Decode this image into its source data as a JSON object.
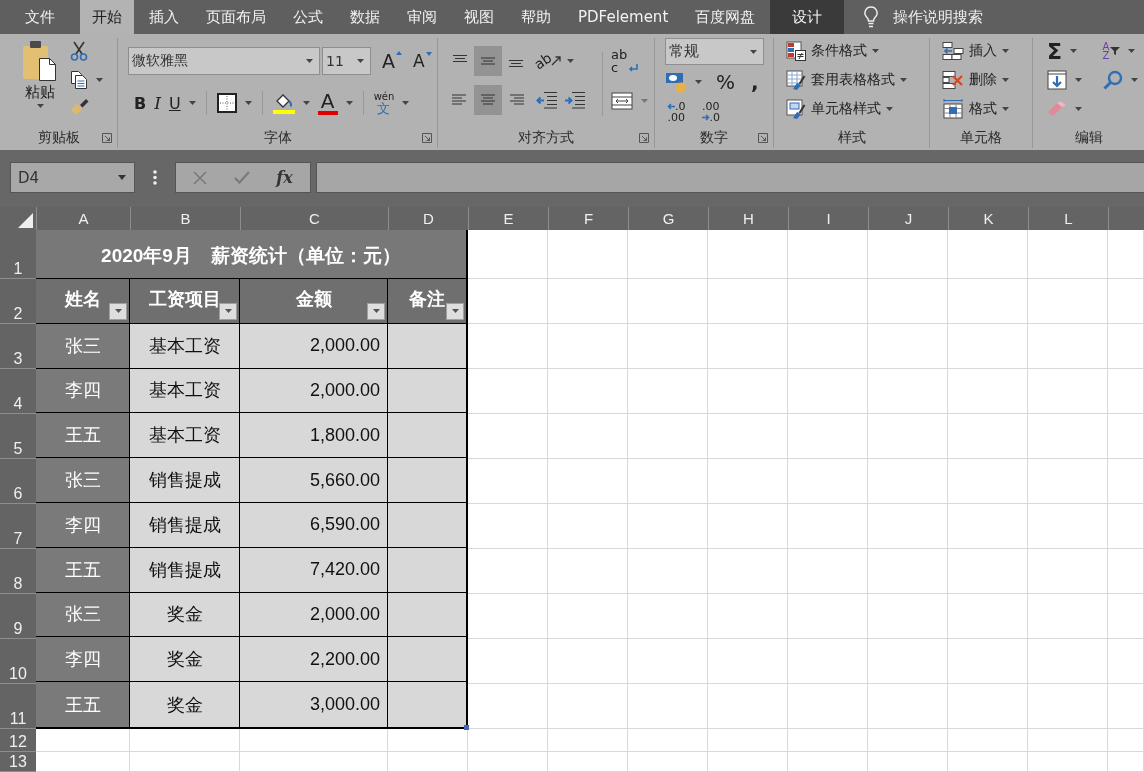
{
  "menu_tabs": [
    {
      "label": "文件",
      "kind": "file",
      "selected": false
    },
    {
      "label": "开始",
      "kind": "tab",
      "selected": true
    },
    {
      "label": "插入",
      "kind": "tab",
      "selected": false
    },
    {
      "label": "页面布局",
      "kind": "tab",
      "selected": false
    },
    {
      "label": "公式",
      "kind": "tab",
      "selected": false
    },
    {
      "label": "数据",
      "kind": "tab",
      "selected": false
    },
    {
      "label": "审阅",
      "kind": "tab",
      "selected": false
    },
    {
      "label": "视图",
      "kind": "tab",
      "selected": false
    },
    {
      "label": "帮助",
      "kind": "tab",
      "selected": false
    },
    {
      "label": "PDFelement",
      "kind": "tab",
      "selected": false
    },
    {
      "label": "百度网盘",
      "kind": "tab",
      "selected": false
    },
    {
      "label": "设计",
      "kind": "contextual",
      "selected": false
    }
  ],
  "tell_me": {
    "label": "操作说明搜索"
  },
  "ribbon": {
    "clipboard": {
      "label": "剪贴板",
      "launcher": true,
      "paste": "粘贴"
    },
    "font": {
      "label": "字体",
      "launcher": true,
      "font_name": "微软雅黑",
      "font_size": "11",
      "grow": "A",
      "shrink": "A",
      "bold": "B",
      "italic": "I",
      "underline": "U",
      "font_color": "A",
      "phonetic_top": "wén",
      "phonetic_bottom": "文"
    },
    "alignment": {
      "label": "对齐方式",
      "launcher": true,
      "vertical": [
        {
          "kind": "top",
          "selected": false
        },
        {
          "kind": "middle",
          "selected": true
        },
        {
          "kind": "bottom",
          "selected": false
        }
      ],
      "horizontal": [
        {
          "kind": "left",
          "selected": false
        },
        {
          "kind": "center",
          "selected": true
        },
        {
          "kind": "right",
          "selected": false
        }
      ],
      "orientation": "ab",
      "wrap_top": "ab",
      "wrap_bottom": "c"
    },
    "number": {
      "label": "数字",
      "launcher": true,
      "format": "常规",
      "percent": "%",
      "comma": ",",
      "increase_decimal": [
        ".0",
        ".00"
      ],
      "decrease_decimal": [
        ".00",
        ".0"
      ]
    },
    "styles": {
      "label": "样式",
      "launcher": false,
      "items": [
        {
          "kind": "conditional",
          "label": "条件格式"
        },
        {
          "kind": "table",
          "label": "套用表格格式"
        },
        {
          "kind": "cell",
          "label": "单元格样式"
        }
      ]
    },
    "cells": {
      "label": "单元格",
      "launcher": false,
      "items": [
        {
          "kind": "insert",
          "label": "插入"
        },
        {
          "kind": "delete",
          "label": "删除"
        },
        {
          "kind": "format",
          "label": "格式"
        }
      ]
    },
    "editing": {
      "label": "编辑",
      "launcher": false,
      "sum": "Σ",
      "sort": [
        "A",
        "Z"
      ]
    }
  },
  "formula_bar": {
    "name_box": "D4",
    "insert_function": "fx"
  },
  "sheet": {
    "columns": [
      "A",
      "B",
      "C",
      "D",
      "E",
      "F",
      "G",
      "H",
      "I",
      "J",
      "K",
      "L"
    ],
    "rows": [
      "1",
      "2",
      "3",
      "4",
      "5",
      "6",
      "7",
      "8",
      "9",
      "10",
      "11",
      "12",
      "13"
    ]
  },
  "table": {
    "title": "2020年9月　薪资统计（单位：元）",
    "headers": [
      {
        "label": "姓名"
      },
      {
        "label": "工资项目"
      },
      {
        "label": "金额"
      },
      {
        "label": "备注"
      }
    ],
    "records": [
      {
        "name": "张三",
        "item": "基本工资",
        "amount": "2,000.00"
      },
      {
        "name": "李四",
        "item": "基本工资",
        "amount": "2,000.00"
      },
      {
        "name": "王五",
        "item": "基本工资",
        "amount": "1,800.00"
      },
      {
        "name": "张三",
        "item": "销售提成",
        "amount": "5,660.00"
      },
      {
        "name": "李四",
        "item": "销售提成",
        "amount": "6,590.00"
      },
      {
        "name": "王五",
        "item": "销售提成",
        "amount": "7,420.00"
      },
      {
        "name": "张三",
        "item": "奖金",
        "amount": "2,000.00"
      },
      {
        "name": "李四",
        "item": "奖金",
        "amount": "2,200.00"
      },
      {
        "name": "王五",
        "item": "奖金",
        "amount": "3,000.00"
      }
    ]
  }
}
